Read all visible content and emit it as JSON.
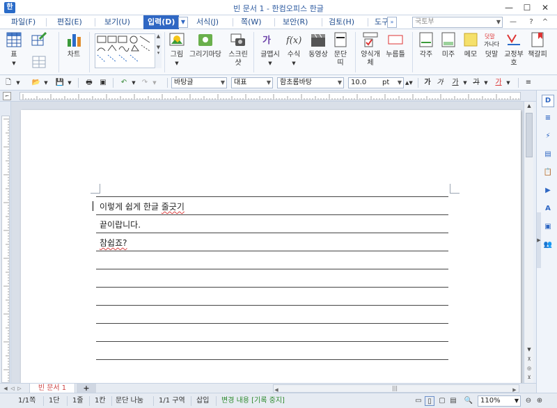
{
  "window": {
    "title": "빈 문서 1 - 한컴오피스 한글",
    "minimize": "—",
    "maximize": "☐",
    "close": "✕"
  },
  "menu": {
    "items": [
      {
        "label": "파일(F)",
        "active": false
      },
      {
        "label": "편집(E)",
        "active": false
      },
      {
        "label": "보기(U)",
        "active": false
      },
      {
        "label": "입력(D)",
        "active": true
      },
      {
        "label": "서식(J)",
        "active": false
      },
      {
        "label": "쪽(W)",
        "active": false
      },
      {
        "label": "보안(R)",
        "active": false
      },
      {
        "label": "검토(H)",
        "active": false
      },
      {
        "label": "도구",
        "active": false
      }
    ],
    "font_search_value": "국토부",
    "help": "?",
    "collapse": "^"
  },
  "ribbon": {
    "table": "표",
    "chart": "차트",
    "picture": "그림",
    "draw_shape": "그리기마당",
    "screenshot": "스크린샷",
    "glyph": "글맵시",
    "formula": "수식",
    "video": "동영상",
    "paragraph": "문단띠",
    "form_object": "양식개체",
    "button": "누름틀",
    "footnote": "각주",
    "endnote": "미주",
    "memo": "메모",
    "overlap": "덧말",
    "proofread": "교정부호",
    "bookmark": "책갈피"
  },
  "format_toolbar": {
    "style": "바탕글",
    "language": "대표",
    "font": "함초롬바탕",
    "size": "10.0",
    "unit": "pt",
    "bold": "가",
    "italic": "가",
    "underline": "가",
    "strike": "가",
    "color": "가"
  },
  "document": {
    "lines": [
      "이렇게 쉽게 한글 줄긋기",
      "끝이랍니다.",
      "참쉽죠?"
    ]
  },
  "side_panel": {
    "buttons": [
      "D",
      "≡",
      "⚡",
      "▤",
      "📋",
      "▶",
      "A",
      "▣",
      "👥"
    ]
  },
  "tabs": {
    "doc_tab": "빈 문서 1",
    "add": "+"
  },
  "status": {
    "page": "1/1쪽",
    "column": "1단",
    "line": "1줄",
    "col": "1칸",
    "break": "문단 나눔",
    "section": "1/1 구역",
    "mode": "삽입",
    "track": "변경 내용 [기록 중지]",
    "zoom": "110%"
  }
}
